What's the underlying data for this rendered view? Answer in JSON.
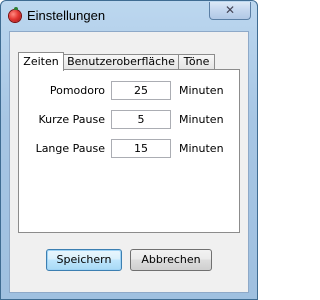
{
  "window": {
    "title": "Einstellungen",
    "close_label": "✕"
  },
  "tabs": [
    {
      "label": "Zeiten",
      "active": true
    },
    {
      "label": "Benutzeroberfläche",
      "active": false
    },
    {
      "label": "Töne",
      "active": false
    }
  ],
  "fields": [
    {
      "label": "Pomodoro",
      "value": "25",
      "unit": "Minuten"
    },
    {
      "label": "Kurze Pause",
      "value": "5",
      "unit": "Minuten"
    },
    {
      "label": "Lange Pause",
      "value": "15",
      "unit": "Minuten"
    }
  ],
  "buttons": {
    "save_label": "Speichern",
    "cancel_label": "Abbrechen"
  },
  "colors": {
    "frame": "#a7c6e4",
    "client": "#f0f0f0",
    "primary_button_border": "#3c7fb1"
  },
  "icons": {
    "app": "tomato-icon",
    "close": "close-icon"
  }
}
